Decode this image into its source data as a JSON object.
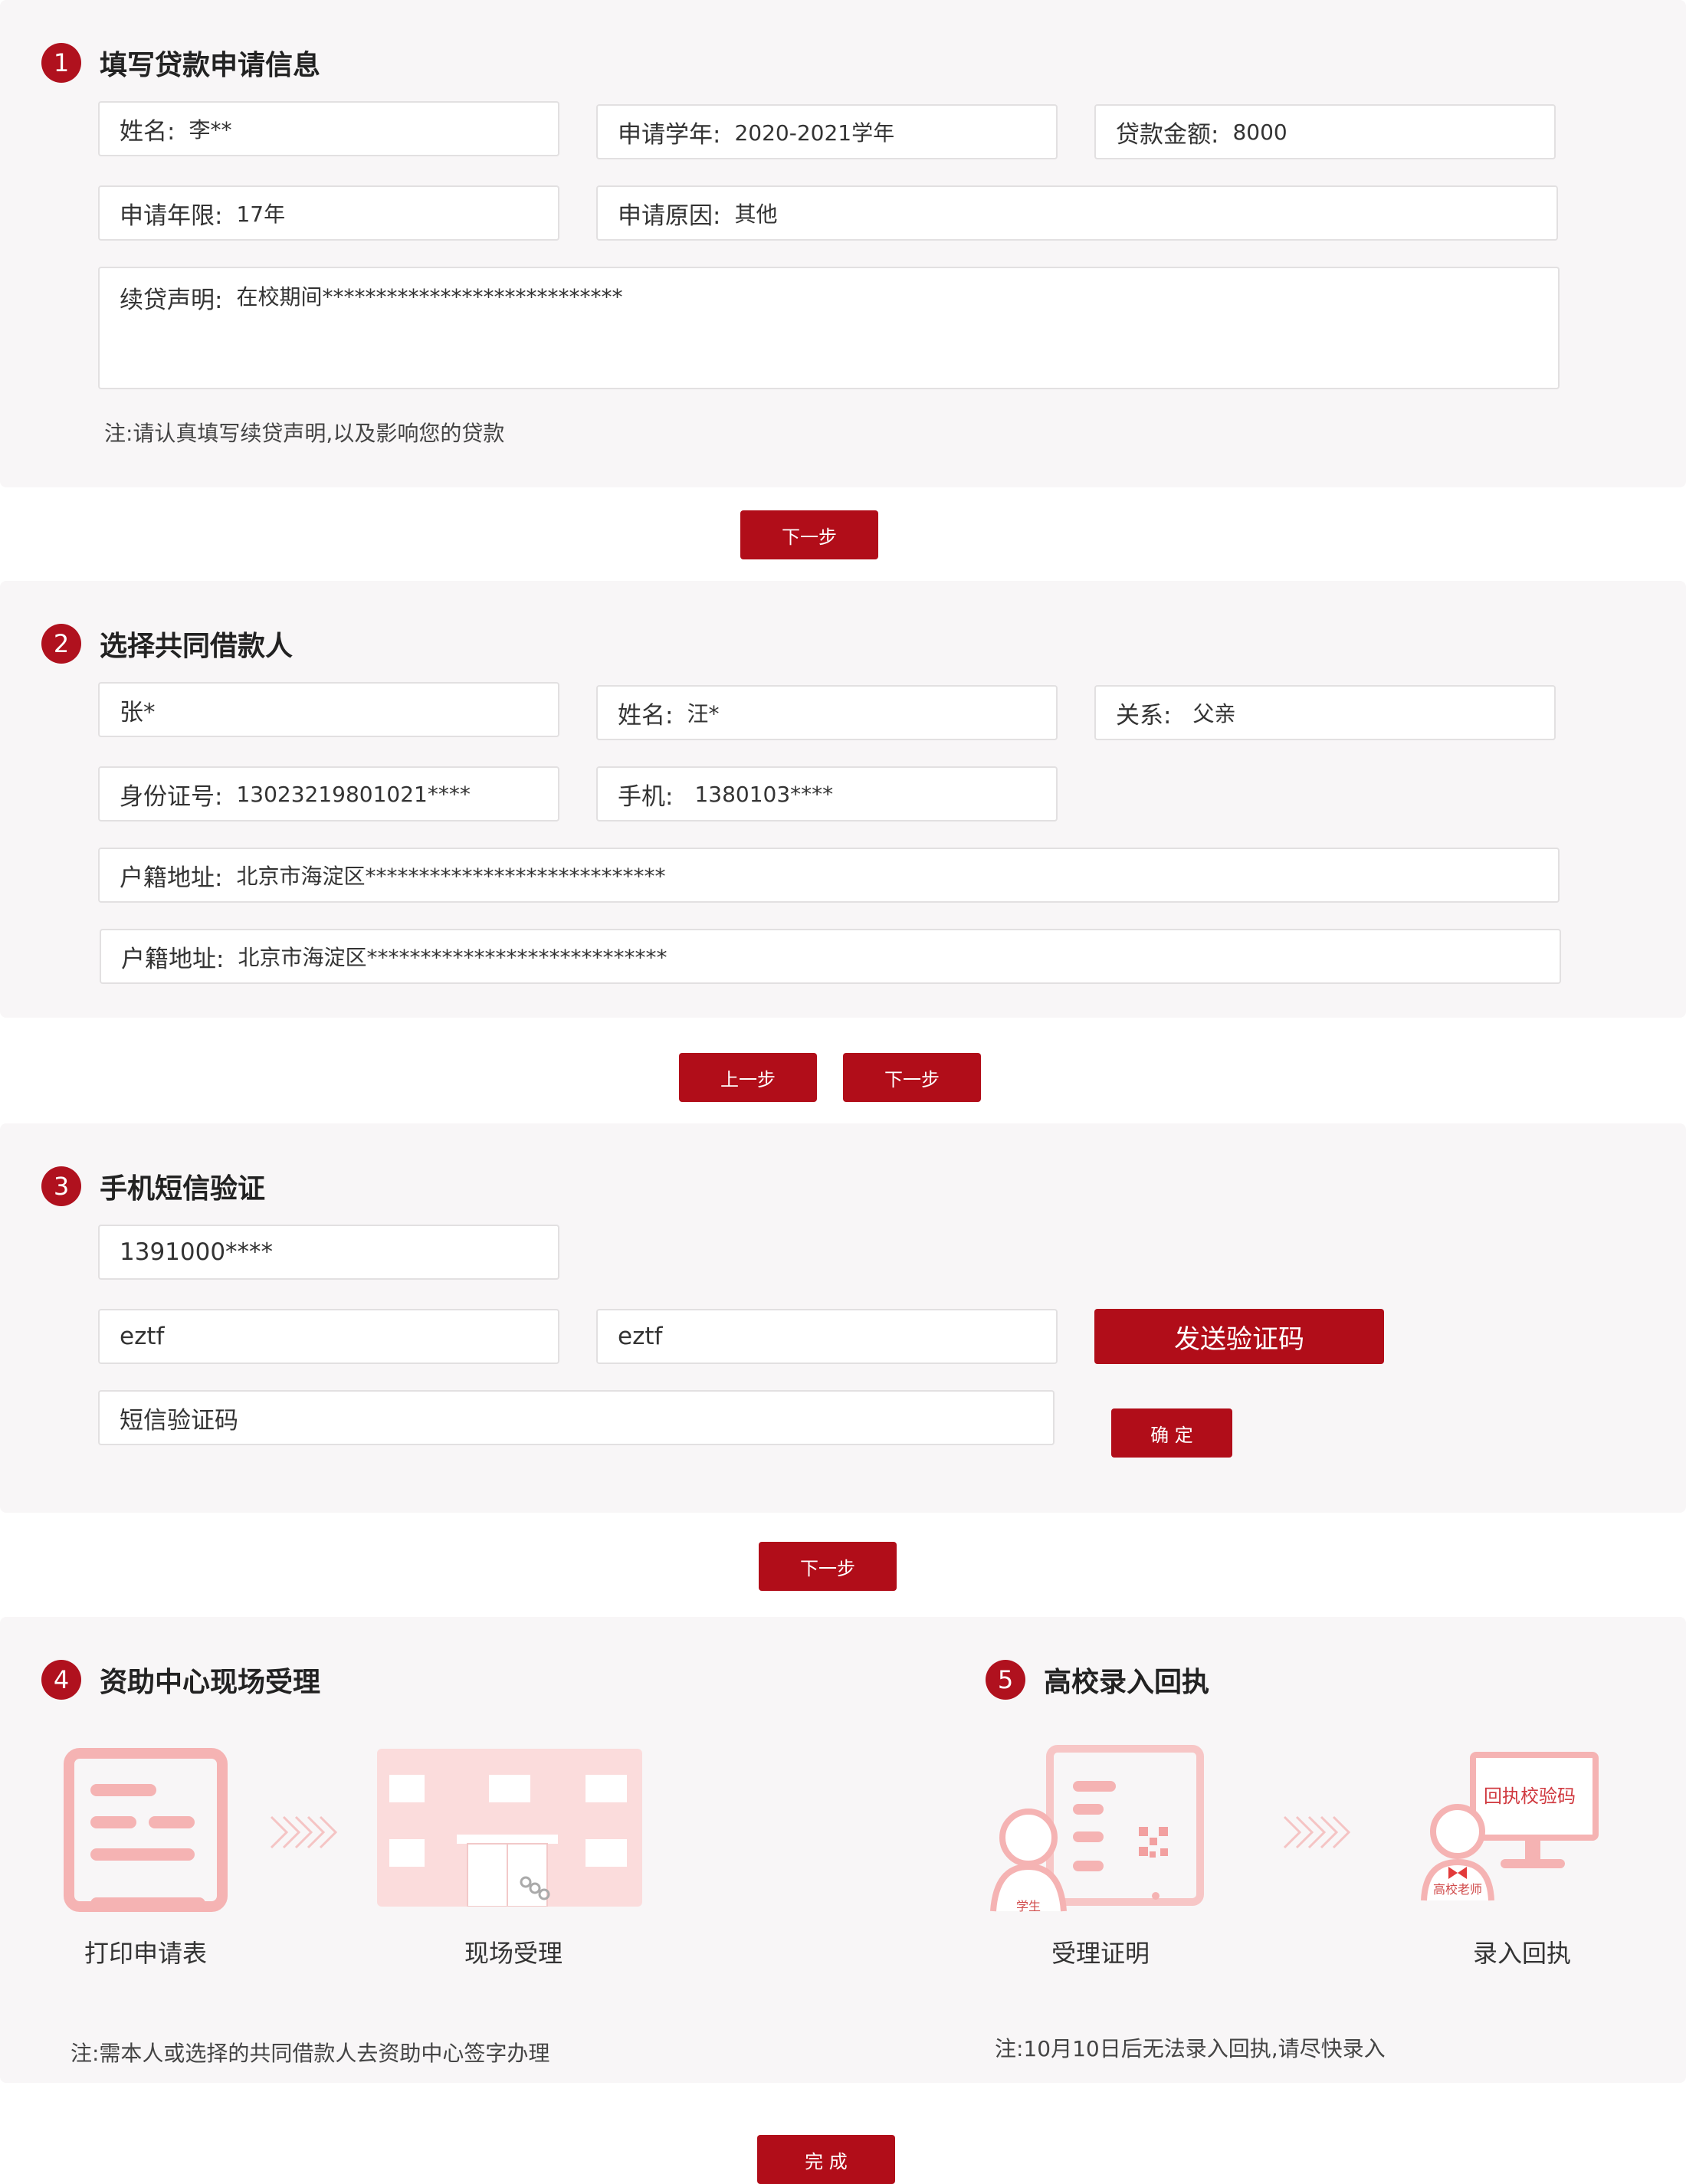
{
  "colors": {
    "accent": "#b10d19",
    "panel": "#f8f6f7",
    "illustration": "#f5b3b3"
  },
  "step1": {
    "num": "1",
    "title": "填写贷款申请信息",
    "name_label": "姓名:",
    "name_value": "李**",
    "year_label": "申请学年:",
    "year_value": "2020-2021学年",
    "amount_label": "贷款金额:",
    "amount_value": "8000",
    "term_label": "申请年限:",
    "term_value": "17年",
    "reason_label": "申请原因:",
    "reason_value": "其他",
    "statement_label": "续贷声明:",
    "statement_value": "在校期间****************************",
    "note": "注:请认真填写续贷声明,以及影响您的贷款",
    "next": "下一步"
  },
  "step2": {
    "num": "2",
    "title": "选择共同借款人",
    "borrower_value": "张*",
    "name_label": "姓名:",
    "name_value": "汪*",
    "relation_label": "关系:",
    "relation_value": "父亲",
    "id_label": "身份证号:",
    "id_value": "13023219801021****",
    "phone_label": "手机:",
    "phone_value": "1380103****",
    "address1_label": "户籍地址:",
    "address1_value": "北京市海淀区****************************",
    "address2_label": "户籍地址:",
    "address2_value": "北京市海淀区****************************",
    "prev": "上一步",
    "next": "下一步"
  },
  "step3": {
    "num": "3",
    "title": "手机短信验证",
    "phone_value": "1391000****",
    "captcha1_value": "eztf",
    "captcha2_value": "eztf",
    "send_code": "发送验证码",
    "sms_placeholder": "短信验证码",
    "confirm": "确 定",
    "next": "下一步"
  },
  "step4": {
    "num": "4",
    "title": "资助中心现场受理",
    "item1": "打印申请表",
    "item2": "现场受理",
    "note": "注:需本人或选择的共同借款人去资助中心签字办理",
    "icons": [
      "form-icon",
      "building-icon"
    ]
  },
  "step5": {
    "num": "5",
    "title": "高校录入回执",
    "item1": "受理证明",
    "item2": "录入回执",
    "student_tag": "学生",
    "teacher_tag": "高校老师",
    "screen_text": "回执校验码",
    "note": "注:10月10日后无法录入回执,请尽快录入"
  },
  "finish": "完 成"
}
